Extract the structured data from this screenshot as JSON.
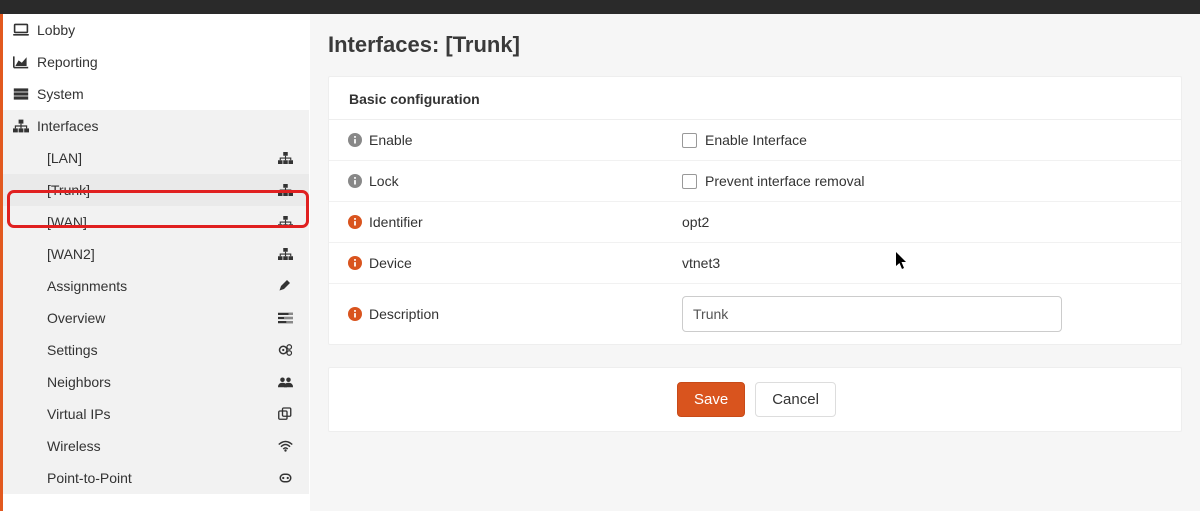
{
  "sidebar": {
    "top": [
      {
        "label": "Lobby",
        "icon": "laptop-icon"
      },
      {
        "label": "Reporting",
        "icon": "area-chart-icon"
      },
      {
        "label": "System",
        "icon": "server-icon"
      }
    ],
    "interfaces_parent": {
      "label": "Interfaces",
      "icon": "sitemap-icon"
    },
    "interfaces": [
      {
        "label": "[LAN]",
        "right_icon": "sitemap-icon"
      },
      {
        "label": "[Trunk]",
        "right_icon": "sitemap-icon",
        "active": true
      },
      {
        "label": "[WAN]",
        "right_icon": "sitemap-icon"
      },
      {
        "label": "[WAN2]",
        "right_icon": "sitemap-icon"
      },
      {
        "label": "Assignments",
        "right_icon": "pencil-icon"
      },
      {
        "label": "Overview",
        "right_icon": "tasks-icon"
      },
      {
        "label": "Settings",
        "right_icon": "cogs-icon"
      },
      {
        "label": "Neighbors",
        "right_icon": "users-icon"
      },
      {
        "label": "Virtual IPs",
        "right_icon": "clone-icon"
      },
      {
        "label": "Wireless",
        "right_icon": "wifi-icon"
      },
      {
        "label": "Point-to-Point",
        "right_icon": "phone-icon"
      }
    ]
  },
  "main": {
    "title": "Interfaces: [Trunk]",
    "panel_header": "Basic configuration",
    "rows": {
      "enable": {
        "label": "Enable",
        "value_label": "Enable Interface",
        "info_color": "#888"
      },
      "lock": {
        "label": "Lock",
        "value_label": "Prevent interface removal",
        "info_color": "#888"
      },
      "identifier": {
        "label": "Identifier",
        "value": "opt2",
        "info_color": "#d9541e"
      },
      "device": {
        "label": "Device",
        "value": "vtnet3",
        "info_color": "#d9541e"
      },
      "description": {
        "label": "Description",
        "value": "Trunk",
        "info_color": "#d9541e"
      }
    },
    "buttons": {
      "save": "Save",
      "cancel": "Cancel"
    }
  }
}
